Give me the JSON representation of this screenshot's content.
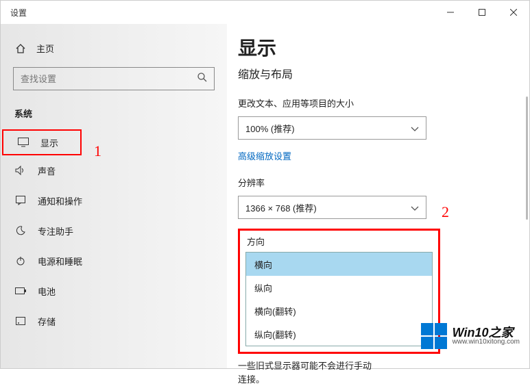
{
  "window": {
    "title": "设置"
  },
  "sidebar": {
    "home": "主页",
    "search_placeholder": "查找设置",
    "category": "系统",
    "items": [
      {
        "label": "显示"
      },
      {
        "label": "声音"
      },
      {
        "label": "通知和操作"
      },
      {
        "label": "专注助手"
      },
      {
        "label": "电源和睡眠"
      },
      {
        "label": "电池"
      },
      {
        "label": "存储"
      }
    ]
  },
  "main": {
    "heading": "显示",
    "subheading": "缩放与布局",
    "scale_label": "更改文本、应用等项目的大小",
    "scale_value": "100% (推荐)",
    "adv_link": "高级缩放设置",
    "res_label": "分辨率",
    "res_value": "1366 × 768 (推荐)",
    "orient_label": "方向",
    "orient_options": [
      "横向",
      "纵向",
      "横向(翻转)",
      "纵向(翻转)"
    ],
    "note": "一些旧式显示器可能不会进行手动连接。"
  },
  "annotations": {
    "a1": "1",
    "a2": "2"
  },
  "watermark": {
    "brand": "Win10之家",
    "url": "www.win10xitong.com"
  }
}
